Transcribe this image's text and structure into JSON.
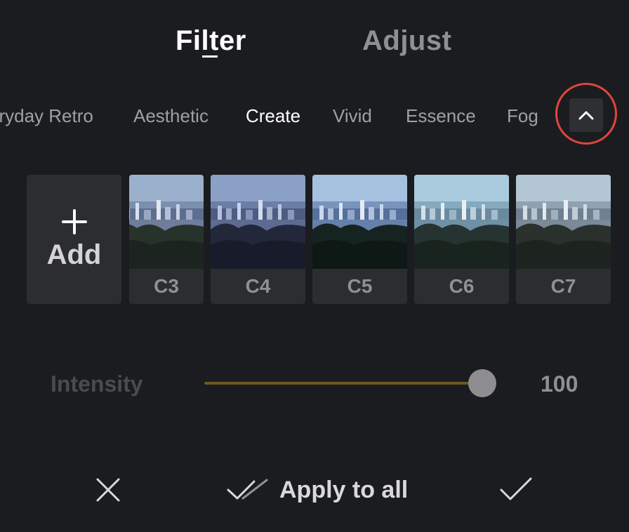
{
  "tabs": {
    "filter": "Filter",
    "adjust": "Adjust"
  },
  "categories": [
    {
      "label": "eryday Retro",
      "active": false
    },
    {
      "label": "Aesthetic",
      "active": false
    },
    {
      "label": "Create",
      "active": true
    },
    {
      "label": "Vivid",
      "active": false
    },
    {
      "label": "Essence",
      "active": false
    },
    {
      "label": "Fog",
      "active": false
    }
  ],
  "collapse_icon": "chevron-up-icon",
  "add_tile": {
    "label": "Add",
    "icon": "plus-icon"
  },
  "filters": [
    {
      "label": "C3"
    },
    {
      "label": "C4"
    },
    {
      "label": "C5"
    },
    {
      "label": "C6"
    },
    {
      "label": "C7"
    }
  ],
  "intensity": {
    "label": "Intensity",
    "value": "100",
    "level": 1.0
  },
  "bottom_bar": {
    "cancel_icon": "close-icon",
    "apply_all_icon": "double-check-icon",
    "apply_all_label": "Apply to all",
    "confirm_icon": "check-icon"
  },
  "colors": {
    "background": "#1b1c1f",
    "active_text": "#ffffff",
    "inactive_text": "#9fa0a4",
    "slider_track": "#6b5a22",
    "highlight_ring": "#e0453f"
  }
}
